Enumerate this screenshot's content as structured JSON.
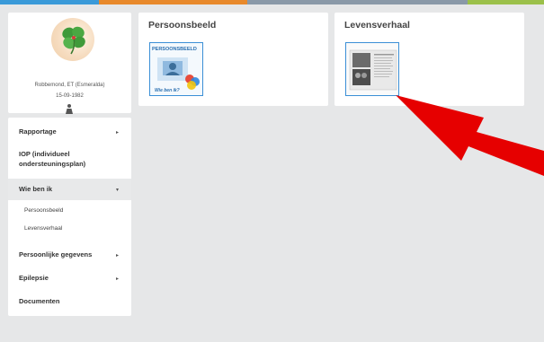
{
  "topbar_colors": [
    "#3a9ad9",
    "#e8892b",
    "#7a8a99",
    "#9bc04a"
  ],
  "profile": {
    "name": "Robbemond, ET  (Esmeralda)",
    "dob": "15-09-1982",
    "avatar_icon": "clover-icon",
    "gender_icon": "person-icon"
  },
  "nav": {
    "items": [
      {
        "label": "Rapportage",
        "chevron": "▸"
      },
      {
        "label": "IOP (individueel",
        "label2": "ondersteuningsplan)"
      },
      {
        "label": "Wie ben ik",
        "chevron": "▾"
      },
      {
        "label": "Persoonlijke gegevens",
        "chevron": "▸"
      },
      {
        "label": "Epilepsie",
        "chevron": "▸"
      },
      {
        "label": "Documenten"
      }
    ],
    "subitems": [
      "Persoonsbeeld",
      "Levensverhaal"
    ]
  },
  "cards": [
    {
      "title": "Persoonsbeeld",
      "thumb_heading": "PERSOONSBEELD",
      "thumb_caption": "Wie ben ik?"
    },
    {
      "title": "Levensverhaal"
    }
  ],
  "accent_colors": {
    "thumb_border": "#3b8fd6",
    "arrow": "#e60000"
  }
}
